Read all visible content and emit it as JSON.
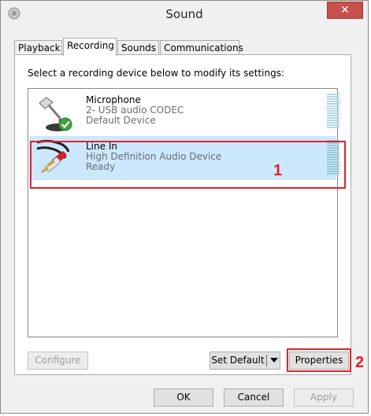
{
  "window": {
    "title": "Sound",
    "close_label": "✕"
  },
  "tabs": [
    {
      "label": "Playback",
      "active": false
    },
    {
      "label": "Recording",
      "active": true
    },
    {
      "label": "Sounds",
      "active": false
    },
    {
      "label": "Communications",
      "active": false
    }
  ],
  "panel": {
    "instruction": "Select a recording device below to modify its settings:"
  },
  "devices": [
    {
      "name": "Microphone",
      "description": "2- USB audio CODEC",
      "status": "Default Device",
      "selected": false,
      "icon": "microphone-icon"
    },
    {
      "name": "Line In",
      "description": "High Definition Audio Device",
      "status": "Ready",
      "selected": true,
      "icon": "rca-cable-icon"
    }
  ],
  "annotations": {
    "marker1": "1",
    "marker2": "2"
  },
  "buttons": {
    "configure": "Configure",
    "set_default": "Set Default",
    "properties": "Properties",
    "ok": "OK",
    "cancel": "Cancel",
    "apply": "Apply"
  },
  "colors": {
    "selection": "#cce8ff",
    "annotation_red": "#e0222a",
    "close_red": "#c7504c"
  }
}
